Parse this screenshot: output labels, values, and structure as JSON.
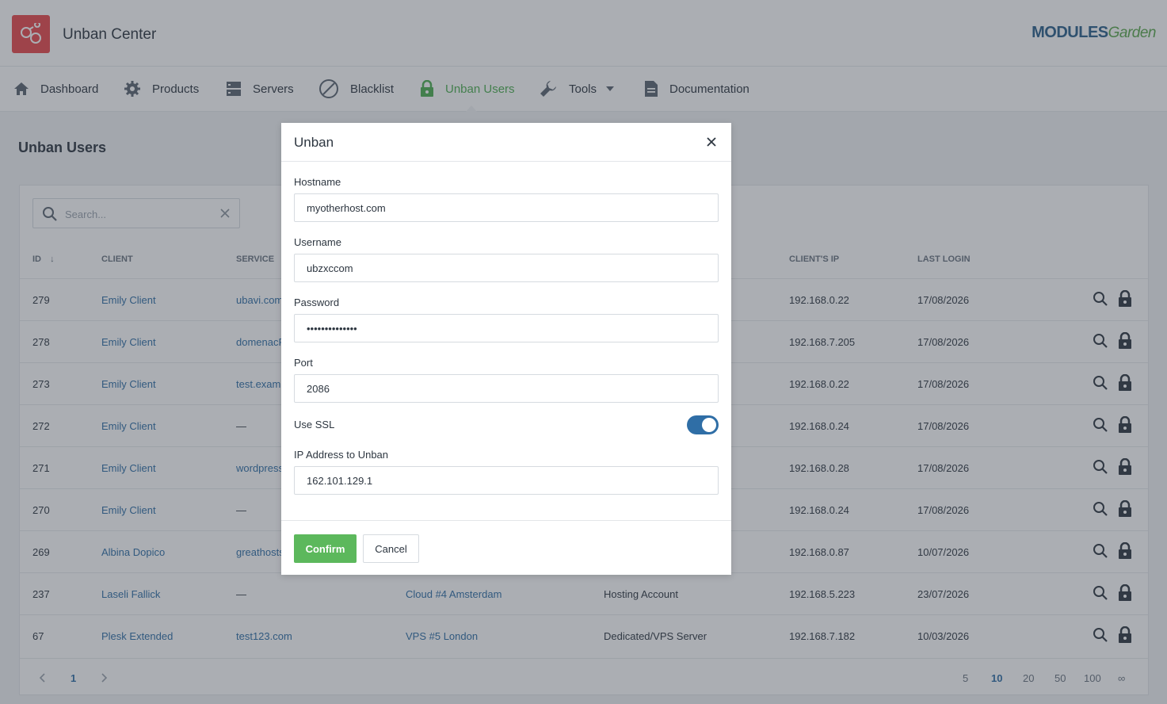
{
  "app": {
    "title": "Unban Center",
    "brand_main": "MODULES",
    "brand_sub": "Garden"
  },
  "nav": {
    "items": [
      {
        "label": "Dashboard"
      },
      {
        "label": "Products"
      },
      {
        "label": "Servers"
      },
      {
        "label": "Blacklist"
      },
      {
        "label": "Unban Users",
        "active": true
      },
      {
        "label": "Tools"
      },
      {
        "label": "Documentation"
      }
    ]
  },
  "page": {
    "title": "Unban Users"
  },
  "search": {
    "placeholder": "Search..."
  },
  "table": {
    "columns": {
      "id": "ID",
      "client": "CLIENT",
      "service": "SERVICE",
      "client_ip": "CLIENT'S IP",
      "last_login": "LAST LOGIN"
    },
    "rows": [
      {
        "id": "279",
        "client": "Emily Client",
        "service": "ubavi.com",
        "server": "",
        "type": "",
        "ip": "192.168.0.22",
        "login": "17/08/2026"
      },
      {
        "id": "278",
        "client": "Emily Client",
        "service": "domenacF",
        "server": "",
        "type": "",
        "ip": "192.168.7.205",
        "login": "17/08/2026"
      },
      {
        "id": "273",
        "client": "Emily Client",
        "service": "test.exam",
        "server": "",
        "type": "",
        "ip": "192.168.0.22",
        "login": "17/08/2026"
      },
      {
        "id": "272",
        "client": "Emily Client",
        "service": "—",
        "server": "",
        "type": "",
        "ip": "192.168.0.24",
        "login": "17/08/2026"
      },
      {
        "id": "271",
        "client": "Emily Client",
        "service": "wordpress",
        "server": "",
        "type": "",
        "ip": "192.168.0.28",
        "login": "17/08/2026"
      },
      {
        "id": "270",
        "client": "Emily Client",
        "service": "—",
        "server": "",
        "type": "",
        "ip": "192.168.0.24",
        "login": "17/08/2026"
      },
      {
        "id": "269",
        "client": "Albina Dopico",
        "service": "greathosts",
        "server": "",
        "type": "",
        "ip": "192.168.0.87",
        "login": "10/07/2026"
      },
      {
        "id": "237",
        "client": "Laseli Fallick",
        "service": "—",
        "server": "Cloud #4 Amsterdam",
        "type": "Hosting Account",
        "ip": "192.168.5.223",
        "login": "23/07/2026"
      },
      {
        "id": "67",
        "client": "Plesk Extended",
        "service": "test123.com",
        "server": "VPS #5 London",
        "type": "Dedicated/VPS Server",
        "ip": "192.168.7.182",
        "login": "10/03/2026"
      }
    ]
  },
  "pagination": {
    "current": "1",
    "sizes": [
      "5",
      "10",
      "20",
      "50",
      "100",
      "∞"
    ],
    "active_size": "10"
  },
  "modal": {
    "title": "Unban",
    "fields": {
      "hostname": {
        "label": "Hostname",
        "value": "myotherhost.com"
      },
      "username": {
        "label": "Username",
        "value": "ubzxccom"
      },
      "password": {
        "label": "Password",
        "value": "••••••••••••••"
      },
      "port": {
        "label": "Port",
        "value": "2086"
      },
      "ssl": {
        "label": "Use SSL",
        "enabled": true
      },
      "ip": {
        "label": "IP Address to Unban",
        "value": "162.101.129.1"
      }
    },
    "confirm_label": "Confirm",
    "cancel_label": "Cancel"
  },
  "colors": {
    "accent": "#4caf50",
    "link": "#2f6ea6",
    "logo_bg": "#e8474a",
    "confirm": "#5cb85c"
  }
}
